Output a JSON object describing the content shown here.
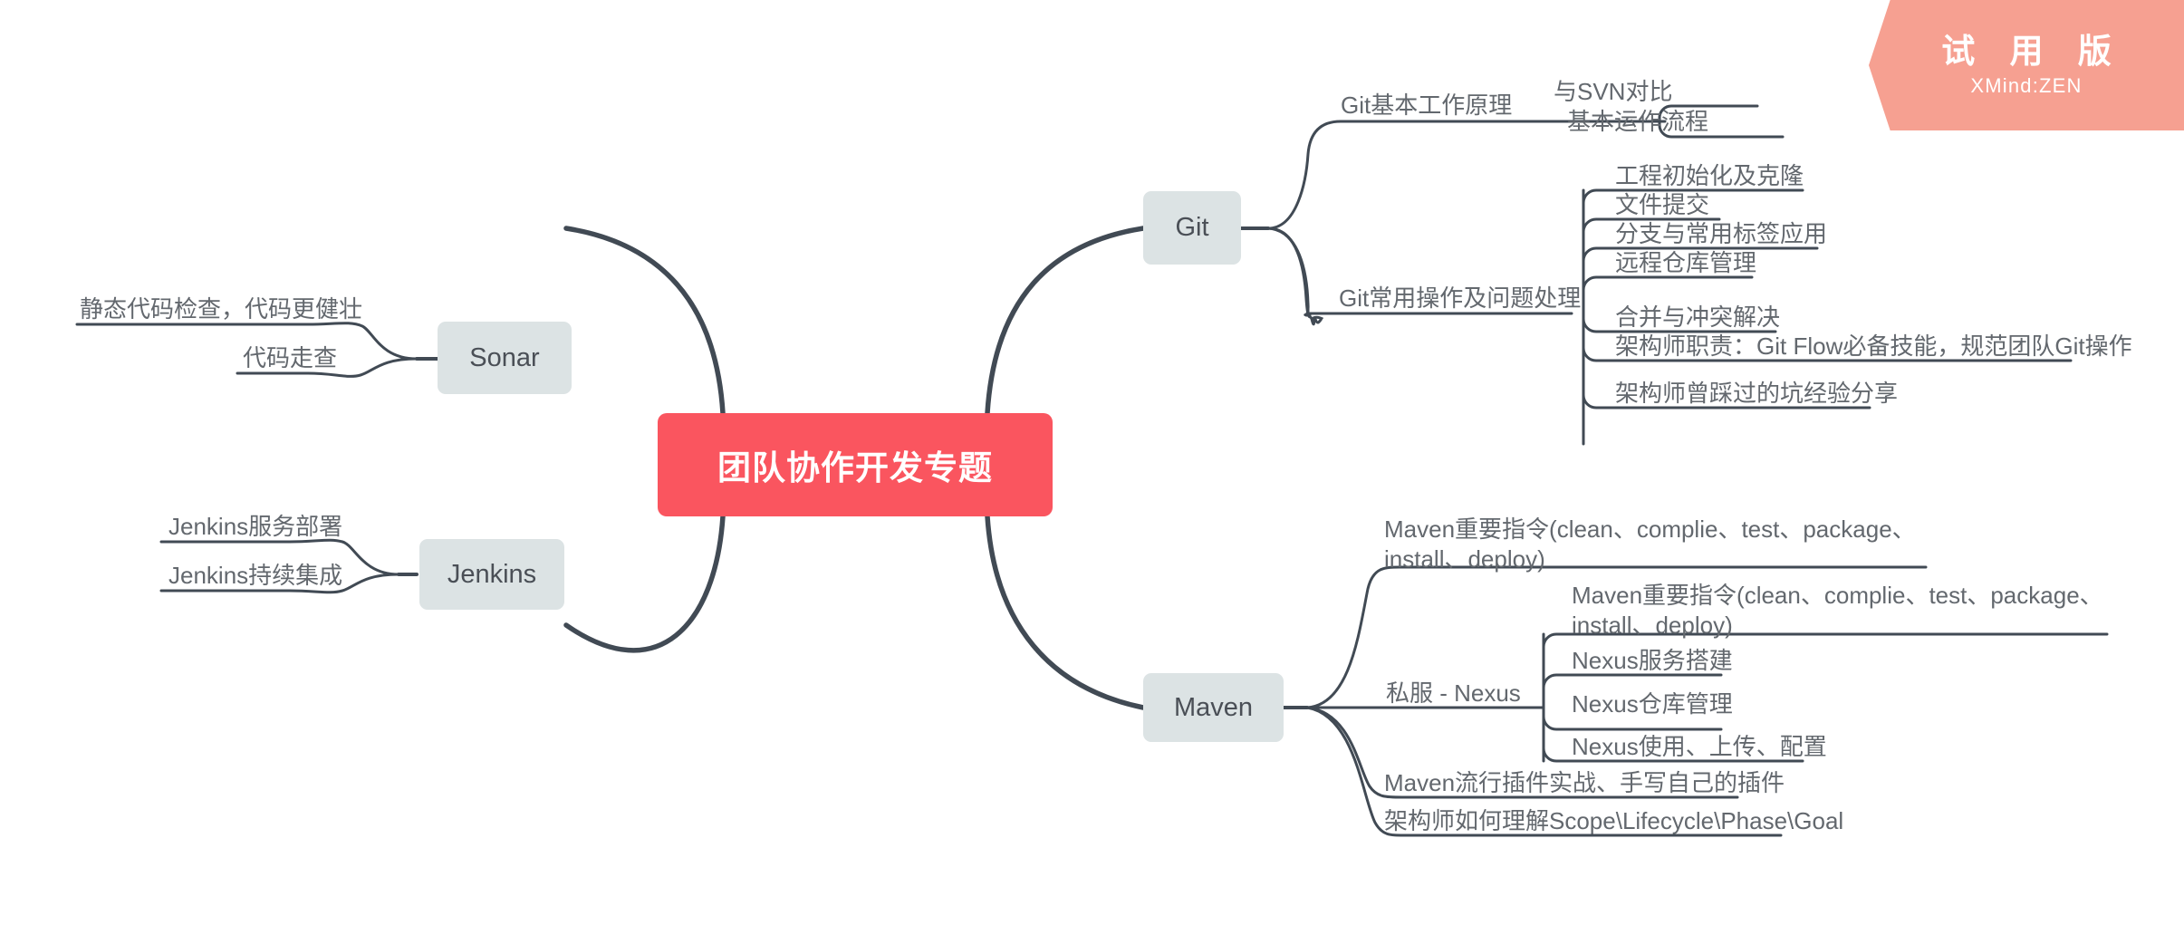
{
  "app": {
    "ribbon": {
      "title": "试 用 版",
      "subtitle": "XMind:ZEN",
      "color": "#F6A091"
    }
  },
  "theme": {
    "root_fill": "#FA555F",
    "root_text": "#FFFFFF",
    "branch_fill": "#DCE3E4",
    "branch_text": "#4A4F56",
    "line_color": "#414A54",
    "topic_text": "#63686E",
    "underline_color": "#69737C",
    "background": "#FFFFFF"
  },
  "mindmap": {
    "root": {
      "label": "团队协作开发专题"
    },
    "branches": [
      {
        "label": "Git",
        "side": "right",
        "children": [
          {
            "label": "Git基本工作原理",
            "children": [
              {
                "label": "与SVN对比"
              },
              {
                "label": "基本运作流程"
              }
            ]
          },
          {
            "label": "Git常用操作及问题处理",
            "children": [
              {
                "label": "工程初始化及克隆"
              },
              {
                "label": "文件提交"
              },
              {
                "label": "分支与常用标签应用"
              },
              {
                "label": "远程仓库管理"
              },
              {
                "label": "合并与冲突解决"
              },
              {
                "label": "架构师职责：Git Flow必备技能，规范团队Git操作"
              },
              {
                "label": "架构师曾踩过的坑经验分享"
              }
            ]
          }
        ]
      },
      {
        "label": "Maven",
        "side": "right",
        "children": [
          {
            "label": "Maven重要指令(clean、complie、test、package、install、deploy)",
            "children": []
          },
          {
            "label": "私服 - Nexus",
            "children": [
              {
                "label": "Maven重要指令(clean、complie、test、package、install、deploy)"
              },
              {
                "label": "Nexus服务搭建"
              },
              {
                "label": "Nexus仓库管理"
              },
              {
                "label": "Nexus使用、上传、配置"
              }
            ]
          },
          {
            "label": "Maven流行插件实战、手写自己的插件",
            "children": []
          },
          {
            "label": "架构师如何理解Scope\\Lifecycle\\Phase\\Goal",
            "children": []
          }
        ]
      },
      {
        "label": "Sonar",
        "side": "left",
        "children": [
          {
            "label": "静态代码检查，代码更健壮"
          },
          {
            "label": "代码走查"
          }
        ]
      },
      {
        "label": "Jenkins",
        "side": "left",
        "children": [
          {
            "label": "Jenkins服务部署"
          },
          {
            "label": "Jenkins持续集成"
          }
        ]
      }
    ]
  }
}
